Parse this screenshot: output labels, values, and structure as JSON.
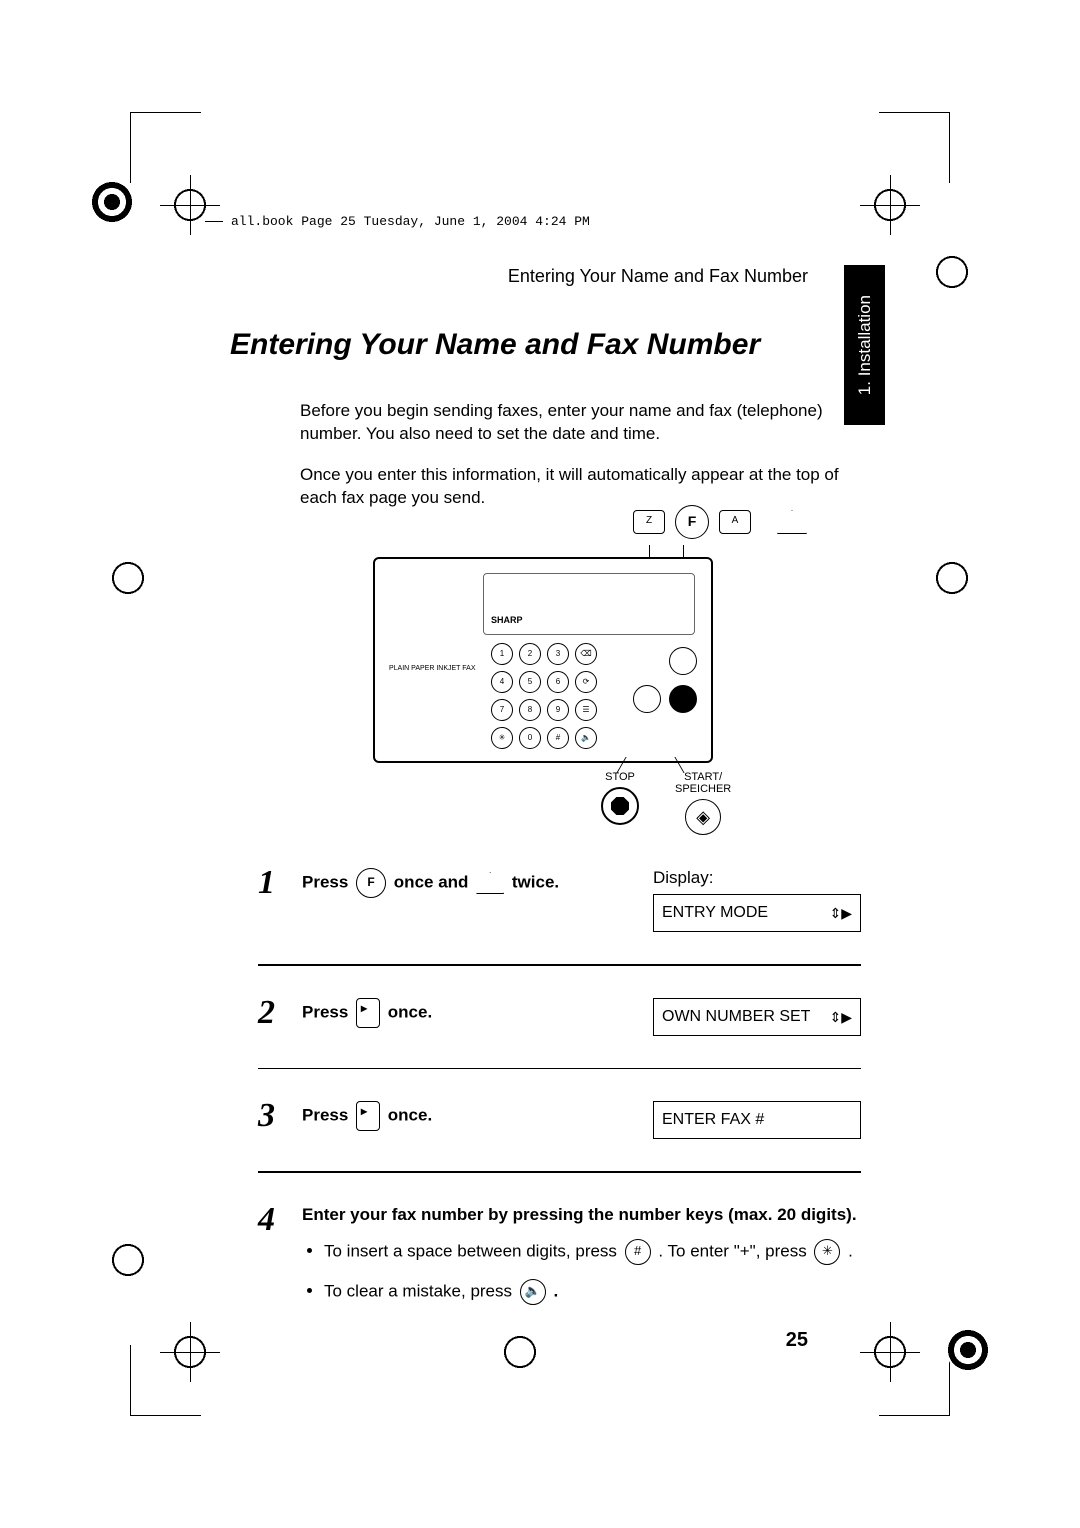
{
  "header_note": "all.book  Page 25  Tuesday, June 1, 2004  4:24 PM",
  "running_head": "Entering Your Name and Fax Number",
  "tab_label": "1. Installation",
  "title": "Entering Your Name and Fax Number",
  "intro": {
    "p1": "Before you begin sending faxes, enter your name and fax (telephone) number. You also need to set the date and time.",
    "p2": "Once you enter this information, it will automatically appear at the top of each fax page you send."
  },
  "illus": {
    "brand": "SHARP",
    "model": "PLAIN PAPER INKJET FAX",
    "fn": "F",
    "z": "Z",
    "a": "A",
    "stop_label": "STOP",
    "start_label": "START/\nSPEICHER"
  },
  "steps": {
    "s1": {
      "num": "1",
      "press": "Press",
      "fn": "F",
      "mid": " once and ",
      "tail": " twice.",
      "disp_label": "Display:",
      "disp_value": "ENTRY MODE"
    },
    "s2": {
      "num": "2",
      "press": "Press ",
      "tail": " once.",
      "disp_value": "OWN NUMBER SET"
    },
    "s3": {
      "num": "3",
      "press": "Press ",
      "tail": " once.",
      "disp_value": "ENTER FAX #"
    },
    "s4": {
      "num": "4",
      "text": "Enter your fax number by pressing the number keys (max. 20 digits).",
      "b1a": "To insert a space between digits, press ",
      "b1b": " . To enter \"+\", press ",
      "b1c": " .",
      "b2a": "To clear a mistake, press ",
      "b2b": "."
    }
  },
  "page_number": "25",
  "icons": {
    "hash": "#",
    "star": "✳",
    "speaker": "🔈"
  }
}
